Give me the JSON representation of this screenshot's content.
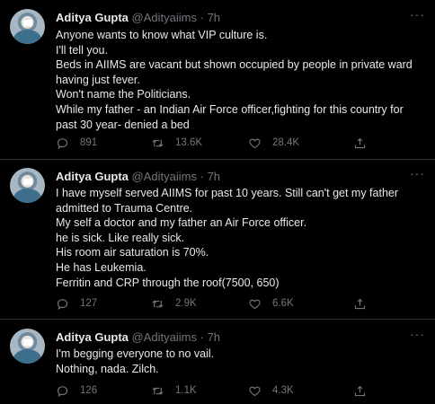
{
  "tweets": [
    {
      "author_name": "Aditya Gupta",
      "handle": "@Adityaiims",
      "separator": "·",
      "time": "7h",
      "more": "···",
      "lines": [
        "Anyone wants to know what VIP culture is.",
        "I'll tell you.",
        "Beds in AIIMS are vacant but shown occupied by people in private ward",
        "having just fever.",
        "Won't name the Politicians.",
        "While my father - an Indian Air Force officer,fighting for this country for",
        "past 30 year- denied a bed"
      ],
      "replies": "891",
      "retweets": "13.6K",
      "likes": "28.4K"
    },
    {
      "author_name": "Aditya Gupta",
      "handle": "@Adityaiims",
      "separator": "·",
      "time": "7h",
      "more": "···",
      "lines": [
        "I have myself served AIIMS for past 10 years. Still can't get my father",
        "admitted to Trauma Centre.",
        "My self a doctor and my father an Air Force officer.",
        "he is sick. Like really sick.",
        "His room air saturation is 70%.",
        "He has Leukemia.",
        "Ferritin and CRP through the roof(7500, 650)"
      ],
      "replies": "127",
      "retweets": "2.9K",
      "likes": "6.6K"
    },
    {
      "author_name": "Aditya Gupta",
      "handle": "@Adityaiims",
      "separator": "·",
      "time": "7h",
      "more": "···",
      "lines": [
        "I'm begging everyone to no vail.",
        "Nothing, nada. Zilch."
      ],
      "replies": "126",
      "retweets": "1.1K",
      "likes": "4.3K"
    }
  ],
  "icons": {
    "reply": "reply-icon",
    "retweet": "retweet-icon",
    "like": "heart-icon",
    "share": "share-icon",
    "more": "more-options-icon"
  },
  "colors": {
    "background": "#000000",
    "text": "#e7e9ea",
    "muted": "#71767b",
    "divider": "#2f3336"
  }
}
